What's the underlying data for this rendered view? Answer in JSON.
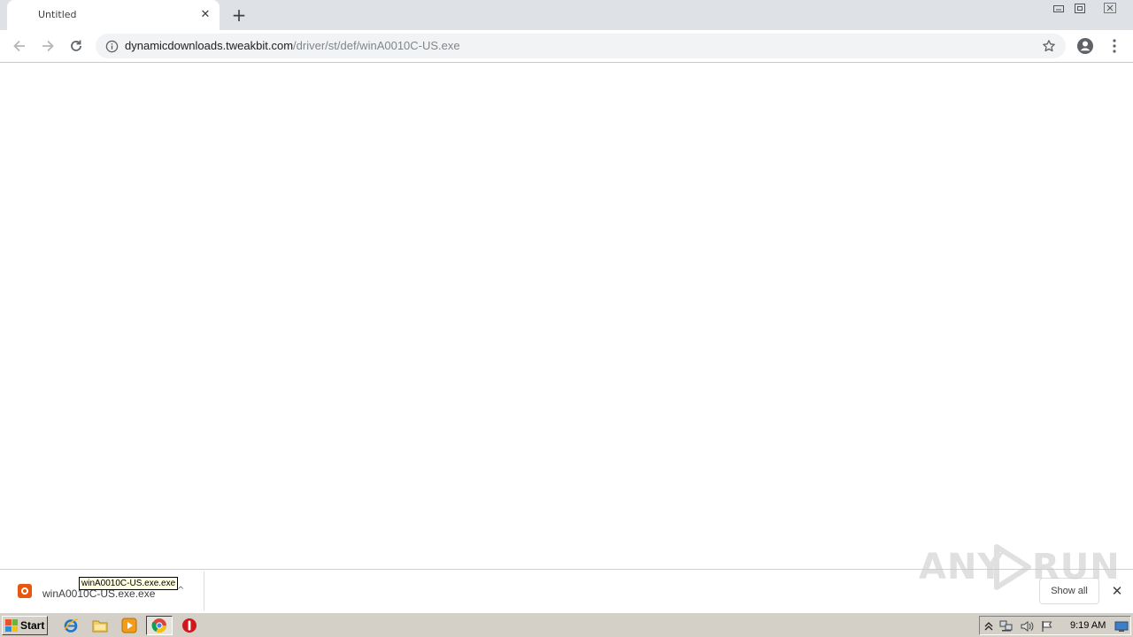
{
  "browser": {
    "tab": {
      "title": "Untitled",
      "close_icon": "close-icon"
    },
    "new_tab_icon": "plus-icon",
    "window_controls": [
      "minimize-icon",
      "restore-icon",
      "close-icon"
    ],
    "toolbar": {
      "back_icon": "arrow-left-icon",
      "forward_icon": "arrow-right-icon",
      "reload_icon": "reload-icon",
      "site_info_icon": "info-icon",
      "url_host": "dynamicdownloads.tweakbit.com",
      "url_path": "/driver/st/def/winA0010C-US.exe",
      "bookmark_icon": "star-icon",
      "profile_icon": "account-icon",
      "menu_icon": "kebab-menu-icon"
    }
  },
  "download_shelf": {
    "item": {
      "filename": "winA0010C-US.exe.exe",
      "icon": "installer-icon"
    },
    "tooltip": "winA0010C-US.exe.exe",
    "show_all_label": "Show all",
    "close_icon": "close-icon"
  },
  "watermark": {
    "left": "ANY",
    "right": "RUN"
  },
  "taskbar": {
    "start_label": "Start",
    "pinned": [
      "internet-explorer-icon",
      "folder-icon",
      "media-player-icon",
      "chrome-icon",
      "antivirus-icon"
    ],
    "tray_icons": [
      "show-hidden-icon",
      "network-icon",
      "volume-icon",
      "action-center-flag-icon",
      "show-desktop-icon"
    ],
    "clock": "9:19 AM"
  },
  "colors": {
    "tabstrip": "#dee1e6",
    "omnibox": "#f1f3f4",
    "taskbar": "#d4d0c8",
    "url_path": "#80868b"
  }
}
